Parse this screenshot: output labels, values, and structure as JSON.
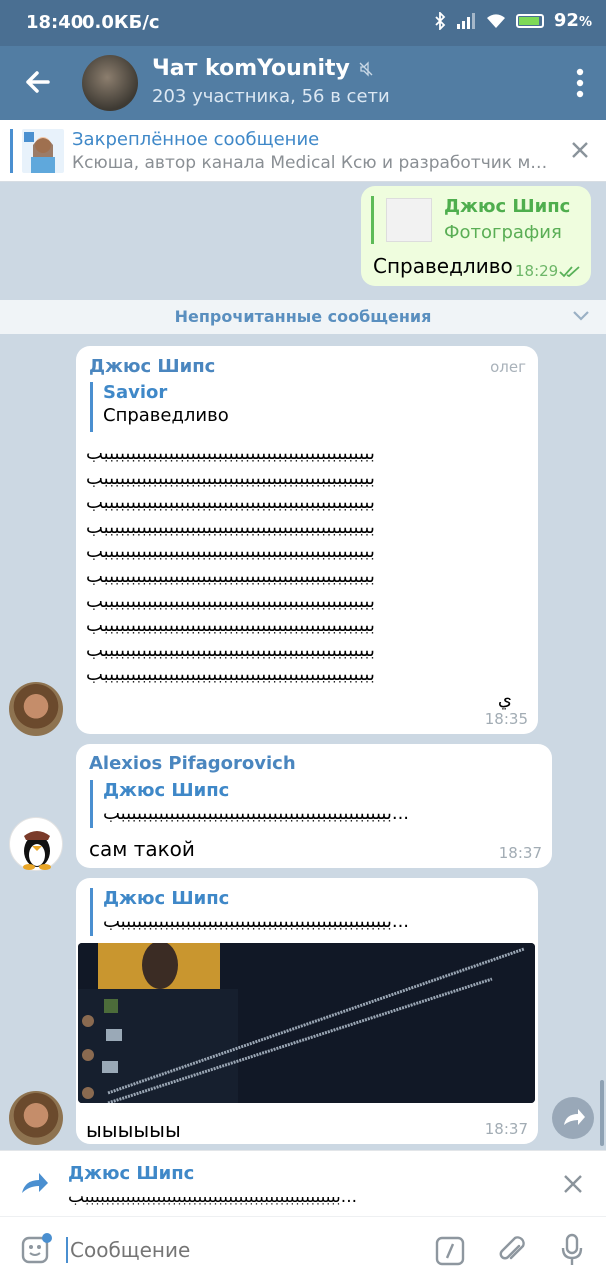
{
  "status_bar": {
    "time": "18:40",
    "speed": "0.0КБ/с",
    "battery": "92",
    "battery_unit": "%"
  },
  "header": {
    "title": "Чат komYounity",
    "subtitle": "203 участника, 56 в сети"
  },
  "pinned": {
    "title": "Закреплённое сообщение",
    "text": "Ксюша, автор канала Medical Ксю и разработчик мед..."
  },
  "messages": {
    "out1": {
      "reply_name": "Джюс Шипс",
      "reply_type": "Фотография",
      "text": "Справедливо",
      "time": "18:29"
    },
    "unread_label": "Непрочитанные сообщения",
    "m1": {
      "sender": "Джюс Шипс",
      "admin_tag": "олег",
      "reply_name": "Savior",
      "reply_text": "Справедливо",
      "lines": [
        "ببببببببببببببببببببببببببببببببببببببببببببببببببب",
        "ببببببببببببببببببببببببببببببببببببببببببببببببببب",
        "ببببببببببببببببببببببببببببببببببببببببببببببببببب",
        "ببببببببببببببببببببببببببببببببببببببببببببببببببب",
        "ببببببببببببببببببببببببببببببببببببببببببببببببببب",
        "ببببببببببببببببببببببببببببببببببببببببببببببببببب",
        "ببببببببببببببببببببببببببببببببببببببببببببببببببب",
        "ببببببببببببببببببببببببببببببببببببببببببببببببببب",
        "ببببببببببببببببببببببببببببببببببببببببببببببببببب",
        "ببببببببببببببببببببببببببببببببببببببببببببببببببب",
        "ي"
      ],
      "time": "18:35"
    },
    "m2": {
      "sender": "Alexios Pifagorovich",
      "reply_name": "Джюс Шипс",
      "reply_text": "ببببببببببببببببببببببببببببببببببببببببببببببببببب...",
      "text": "сам такой",
      "time": "18:37"
    },
    "m3": {
      "reply_name": "Джюс Шипс",
      "reply_text": "ببببببببببببببببببببببببببببببببببببببببببببببببببب...",
      "text": "ыыыыыы",
      "time": "18:37"
    }
  },
  "reply_panel": {
    "name": "Джюс Шипс",
    "text": "ببببببببببببببببببببببببببببببببببببببببببببببببببب..."
  },
  "composer": {
    "placeholder": "Сообщение"
  },
  "colors": {
    "header": "#527da3",
    "status": "#4a6f92",
    "accent": "#3f88c8",
    "chat_bg": "#ccd8e3",
    "outgoing": "#effdde"
  }
}
